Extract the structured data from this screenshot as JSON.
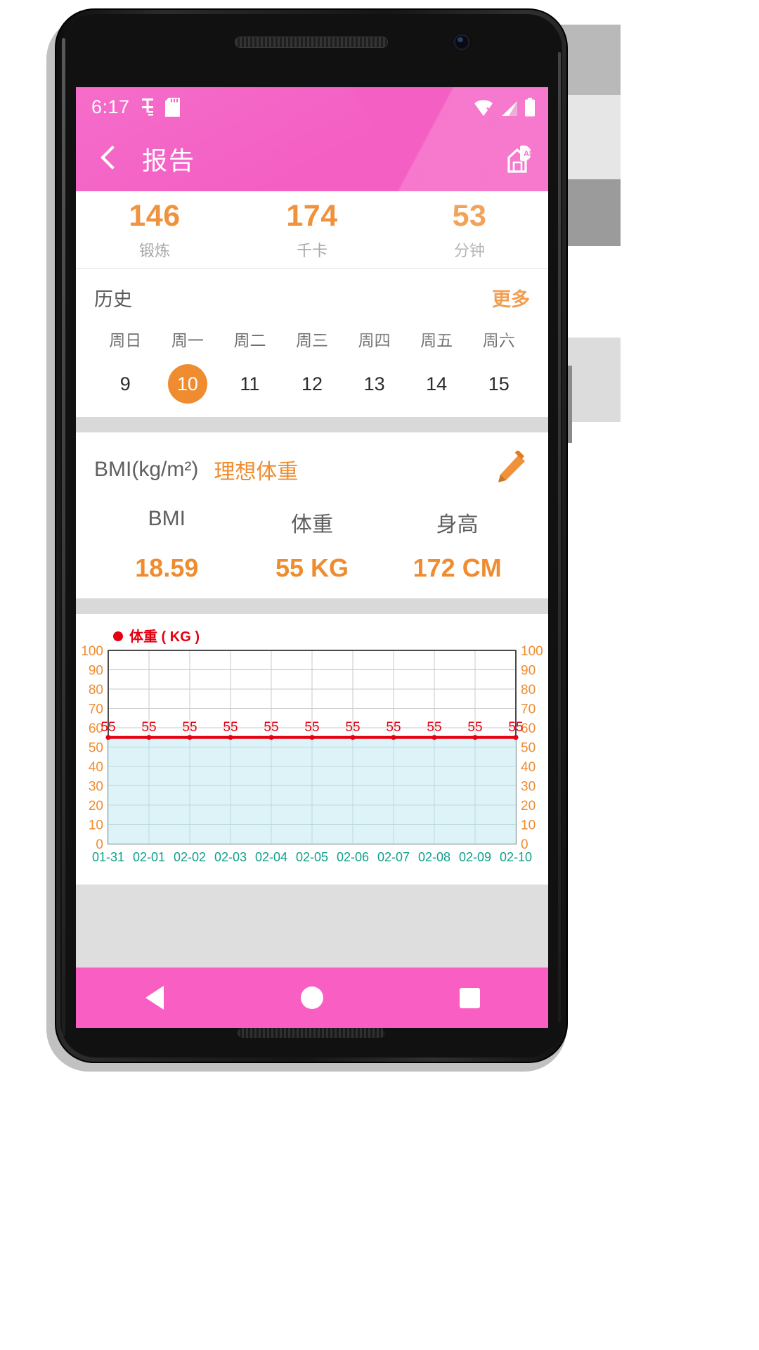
{
  "status_bar": {
    "time": "6:17",
    "left_icons": [
      "usb-debug-icon",
      "sd-card-icon"
    ],
    "right_icons": [
      "wifi-icon",
      "signal-icon",
      "battery-icon"
    ]
  },
  "app_bar": {
    "title": "报告",
    "back_icon": "back-chevron-icon",
    "action_icon": "ad-badge-icon"
  },
  "stats": [
    {
      "value": "146",
      "label": "锻炼"
    },
    {
      "value": "174",
      "label": "千卡"
    },
    {
      "value": "53",
      "label": "分钟"
    }
  ],
  "history": {
    "title": "历史",
    "more_label": "更多",
    "weekdays": [
      "周日",
      "周一",
      "周二",
      "周三",
      "周四",
      "周五",
      "周六"
    ],
    "dates": [
      "9",
      "10",
      "11",
      "12",
      "13",
      "14",
      "15"
    ],
    "selected_index": 1
  },
  "bmi": {
    "unit_label": "BMI(kg/m²)",
    "ideal_weight_label": "理想体重",
    "edit_icon": "pencil-icon",
    "labels": [
      "BMI",
      "体重",
      "身高"
    ],
    "values": [
      "18.59",
      "55 KG",
      "172 CM"
    ]
  },
  "nav_bar": {
    "back_icon": "nav-back-triangle-icon",
    "home_icon": "nav-home-circle-icon",
    "recents_icon": "nav-recents-square-icon"
  },
  "colors": {
    "pink": "#f45fc4",
    "nav_pink": "#f95fc2",
    "orange": "#ef8c2f",
    "chart_line": "#e60012",
    "chart_fill": "#ddf3f7",
    "axis_label": "#ef8c2f",
    "x_label": "#0fa08c"
  },
  "chart_data": {
    "type": "line",
    "title": "",
    "legend": [
      {
        "name": "体重 ( KG )",
        "color": "#e60012",
        "marker": "circle"
      }
    ],
    "legend_position": "top-left",
    "x": [
      "01-31",
      "02-01",
      "02-02",
      "02-03",
      "02-04",
      "02-05",
      "02-06",
      "02-07",
      "02-08",
      "02-09",
      "02-10"
    ],
    "series": [
      {
        "name": "体重 ( KG )",
        "values": [
          55,
          55,
          55,
          55,
          55,
          55,
          55,
          55,
          55,
          55,
          55
        ],
        "point_labels": [
          "55",
          "55",
          "55",
          "55",
          "55",
          "55",
          "55",
          "55",
          "55",
          "55",
          "55"
        ]
      }
    ],
    "ylim": [
      0,
      100
    ],
    "yticks": [
      0,
      10,
      20,
      30,
      40,
      50,
      60,
      70,
      80,
      90,
      100
    ],
    "y_axis_left_labels": [
      "100",
      "90",
      "80",
      "70",
      "60",
      "50",
      "40",
      "30",
      "20",
      "10",
      "0"
    ],
    "y_axis_right_labels": [
      "100",
      "90",
      "80",
      "70",
      "60",
      "50",
      "40",
      "30",
      "20",
      "10",
      "0"
    ],
    "xlabel": "",
    "ylabel": "",
    "grid": true,
    "fill_below": true,
    "fill_color": "#ddf3f7",
    "dual_y_axis": true
  }
}
